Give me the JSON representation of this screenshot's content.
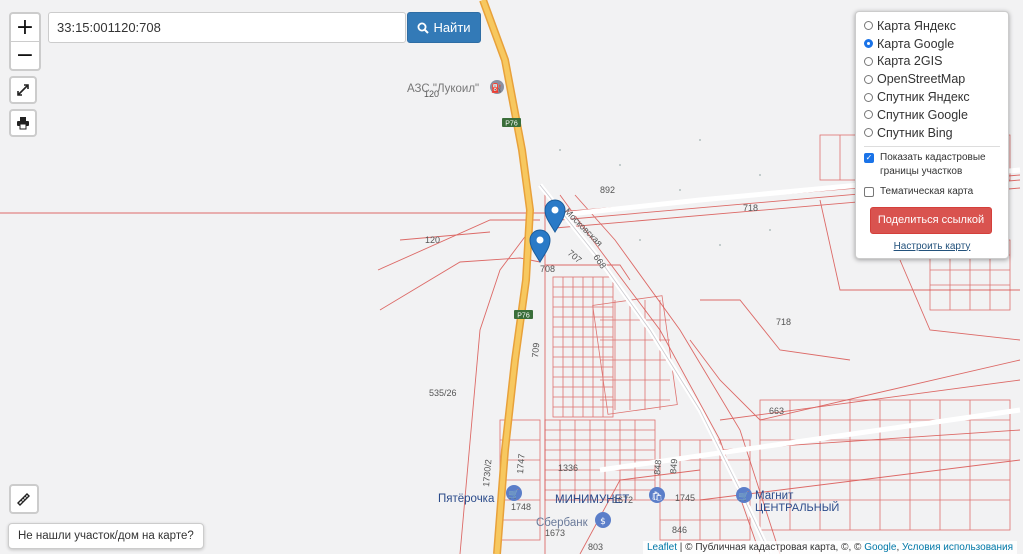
{
  "search": {
    "value": "33:15:001120:708",
    "button_label": "Найти"
  },
  "layers": [
    {
      "label": "Карта Яндекс",
      "selected": false
    },
    {
      "label": "Карта Google",
      "selected": true
    },
    {
      "label": "Карта 2GIS",
      "selected": false
    },
    {
      "label": "OpenStreetMap",
      "selected": false
    },
    {
      "label": "Спутник Яндекс",
      "selected": false
    },
    {
      "label": "Спутник Google",
      "selected": false
    },
    {
      "label": "Спутник Bing",
      "selected": false
    }
  ],
  "options": {
    "cadastral_label": "Показать кадастровые границы участков",
    "cadastral_checked": true,
    "thematic_label": "Тематическая карта",
    "thematic_checked": false,
    "share_label": "Поделиться ссылкой",
    "setup_label": "Настроить карту"
  },
  "not_found_label": "Не нашли участок/дом на карте?",
  "attribution": {
    "leaflet": "Leaflet",
    "sep": " | © Публичная кадастровая карта, ©, © ",
    "google": "Google",
    "terms": "Условия использования"
  },
  "map": {
    "places": {
      "azs": "АЗС \"Лукоил\"",
      "pyaterochka": "Пятёрочка",
      "magnit": "Магнит",
      "centralny": "ЦЕНТРАЛЬНЫЙ",
      "magazin": "МИНИМУНЕТ",
      "sberbank": "Сбербанк"
    },
    "roads": {
      "r76a": "Р76",
      "r76b": "Р76"
    },
    "parcels": {
      "p120a": "120",
      "p120b": "120",
      "p892": "892",
      "p718a": "718",
      "p718b": "718",
      "p707": "707",
      "p708": "708",
      "p668": "668",
      "p709": "709",
      "p535": "535/26",
      "p1730": "1730/2",
      "p1747": "1747",
      "p1336": "1336",
      "p1748": "1748",
      "p663": "663",
      "p1745": "1745",
      "p848": "848",
      "p846": "846",
      "p803": "803",
      "p1673": "1673",
      "p1672": "1672",
      "p849": "849",
      "street1": "Московская"
    }
  }
}
